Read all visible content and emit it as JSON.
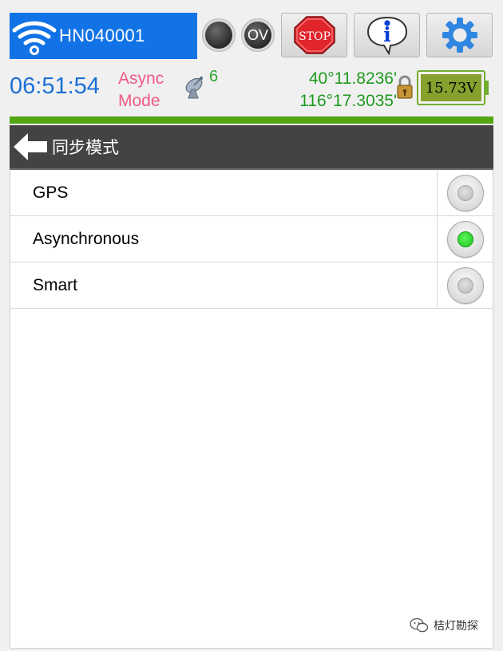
{
  "toolbar": {
    "device_name": "HN040001",
    "ov_label": "OV",
    "stop_label": "STOP",
    "info_label": "i"
  },
  "status": {
    "time": "06:51:54",
    "mode_line1": "Async",
    "mode_line2": "Mode",
    "satellite_count": "6",
    "latitude": "40°11.8236'",
    "longitude": "116°17.3035'",
    "battery_voltage": "15.73V"
  },
  "page": {
    "title": "同步模式"
  },
  "options": [
    {
      "label": "GPS",
      "selected": false
    },
    {
      "label": "Asynchronous",
      "selected": true
    },
    {
      "label": "Smart",
      "selected": false
    }
  ],
  "watermark": {
    "text": "桔灯勘探"
  },
  "colors": {
    "device_box": "#1273e6",
    "clock": "#1a6fd6",
    "mode": "#f05a86",
    "coords": "#1f9a1f",
    "accent_line": "#54a513",
    "header": "#434343",
    "radio_on": "#1ec21e"
  },
  "icons": {
    "wifi": "wifi-icon",
    "status_led": "status-led-icon",
    "stop": "stop-sign-icon",
    "info": "info-icon",
    "settings": "gear-icon",
    "satellite": "satellite-dish-icon",
    "lock": "lock-icon",
    "battery": "battery-icon",
    "back": "back-arrow-icon",
    "wechat": "wechat-icon"
  }
}
